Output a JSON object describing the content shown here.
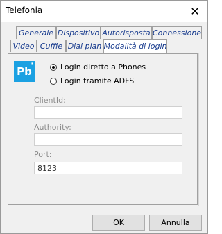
{
  "window": {
    "title": "Telefonia",
    "close_glyph": "✕"
  },
  "tabs": {
    "row_back": [
      {
        "label": "Generale"
      },
      {
        "label": "Dispositivo"
      },
      {
        "label": "Autorisposta"
      },
      {
        "label": "Connessione"
      }
    ],
    "row_front": [
      {
        "label": "Video"
      },
      {
        "label": "Cuffie"
      },
      {
        "label": "Dial plan"
      },
      {
        "label": "Modalità di login",
        "active": true
      }
    ]
  },
  "logo": {
    "text": "Pb",
    "icon": "app-logo-icon",
    "color": "#1ba1e2"
  },
  "login": {
    "options": [
      {
        "label": "Login diretto a Phones",
        "checked": true
      },
      {
        "label": "Login tramite ADFS",
        "checked": false
      }
    ]
  },
  "fields": {
    "clientid": {
      "label": "ClientId:",
      "value": ""
    },
    "authority": {
      "label": "Authority:",
      "value": ""
    },
    "port": {
      "label": "Port:",
      "value": "8123"
    }
  },
  "buttons": {
    "ok": "OK",
    "cancel": "Annulla"
  }
}
